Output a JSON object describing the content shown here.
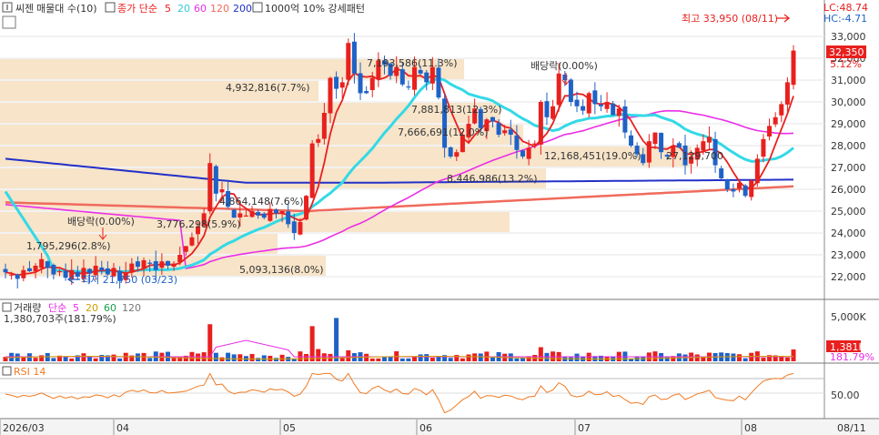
{
  "header": {
    "stock_name": "씨젠",
    "indicator": "매물대 수(10)",
    "ma_label": "종가 단순",
    "ma_periods": [
      "5",
      "20",
      "60",
      "120",
      "200"
    ],
    "pattern_label": "1000억 10% 강세패턴",
    "lc": "LC:48.74",
    "hc": "HC:-4.71"
  },
  "price_panel": {
    "y_ticks": [
      "33,000",
      "32,000",
      "31,000",
      "30,000",
      "29,000",
      "28,000",
      "27,000",
      "26,000",
      "25,000",
      "24,000",
      "23,000",
      "22,000"
    ],
    "current_price": "32,350",
    "current_change": "5.12%",
    "high_label": "최고 33,950 (08/11)",
    "low_label": "최저 21,750 (03/23)",
    "dividend_labels": [
      "배당락(0.00%)",
      "배당락(0.00%)"
    ],
    "volume_profile_labels": [
      "4,932,816(7.7%)",
      "7,193,586(11.3%)",
      "7,881,813(12.3%)",
      "7,666,691(12.0%)",
      "8,446,986(13.2%)",
      "12,168,451(19.0%)",
      "4,864,148(7.6%)",
      "3,776,298(5.9%)",
      "1,795,296(2.8%)",
      "5,093,136(8.0%)",
      "27,129,700"
    ]
  },
  "volume_panel": {
    "title": "거래량",
    "ma_label": "단순",
    "ma_periods": [
      "5",
      "20",
      "60",
      "120"
    ],
    "current_volume": "1,380,703주(181.79%)",
    "y_tick": "5,000K",
    "current_badge": "1,381K",
    "current_pct": "181.79%"
  },
  "rsi_panel": {
    "title": "RSI 14",
    "y_tick": "50.00"
  },
  "x_axis": {
    "labels": [
      "2026/03",
      "04",
      "05",
      "06",
      "07",
      "08",
      "08/11"
    ]
  },
  "colors": {
    "up": "#e8201e",
    "down": "#1f62c7",
    "ma5": "#e8201e",
    "ma20": "#33d9e6",
    "ma60": "#ea2ee6",
    "ma120": "#f06a5c",
    "ma200": "#2230c8",
    "profile": "#f7e4c9",
    "rsi": "#f07a22"
  },
  "chart_data": {
    "type": "candlestick",
    "symbol": "씨젠",
    "x": [
      "2026/03",
      "04",
      "05",
      "06",
      "07",
      "08"
    ],
    "price_ylim": [
      21500,
      34200
    ],
    "last_close": 32350,
    "change_pct": 5.12,
    "high": {
      "value": 33950,
      "date": "08/11"
    },
    "low": {
      "value": 21750,
      "date": "03/23"
    },
    "closes": [
      22200,
      22100,
      21900,
      22300,
      22250,
      22500,
      22800,
      22400,
      22100,
      22250,
      21950,
      22300,
      22000,
      22400,
      22150,
      22500,
      22300,
      22100,
      22400,
      21800,
      22200,
      22600,
      22450,
      22750,
      22600,
      22300,
      22700,
      22500,
      22600,
      23000,
      23400,
      23800,
      24300,
      24900,
      27200,
      25800,
      26000,
      25200,
      24700,
      24900,
      24800,
      25000,
      24800,
      24700,
      25100,
      24900,
      25000,
      24400,
      24000,
      24500,
      25700,
      28100,
      28300,
      29500,
      31100,
      30600,
      30900,
      32700,
      31300,
      30400,
      30400,
      31100,
      31900,
      31700,
      31200,
      31600,
      30800,
      30700,
      31600,
      31300,
      30900,
      31600,
      30200,
      27900,
      27500,
      27700,
      28500,
      29000,
      29700,
      28800,
      29200,
      29100,
      28500,
      28700,
      28500,
      27800,
      27500,
      27900,
      28100,
      30000,
      29300,
      29800,
      31300,
      31000,
      30000,
      29800,
      29600,
      30400,
      29900,
      29800,
      30000,
      29400,
      29700,
      28600,
      28000,
      27600,
      27200,
      28200,
      28600,
      27700,
      27500,
      28000,
      27900,
      27100,
      27500,
      27900,
      28200,
      28400,
      27100,
      26500,
      26000,
      25900,
      26300,
      25700,
      26400,
      27400,
      28300,
      28900,
      29300,
      29900,
      30900,
      32350
    ]
  }
}
